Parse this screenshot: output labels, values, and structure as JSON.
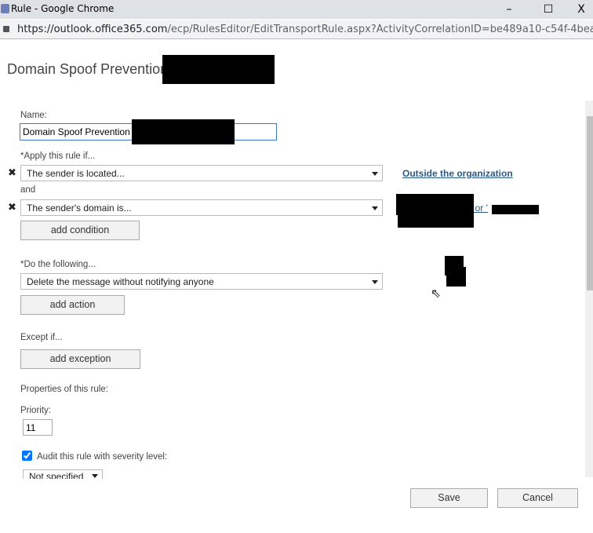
{
  "window": {
    "title": "Rule - Google Chrome",
    "minimize": "–",
    "maximize": "☐",
    "close": "X"
  },
  "address": {
    "host": "https://outlook.office365.com",
    "path": "/ecp/RulesEditor/EditTransportRule.aspx?ActivityCorrelationID=be489a10-c54f-4bea-b..."
  },
  "page": {
    "title": "Domain Spoof Prevention"
  },
  "form": {
    "name_label": "Name:",
    "name_value": "Domain Spoof Prevention",
    "apply_label": "*Apply this rule if...",
    "condition1": "The sender is located...",
    "condition1_value": "Outside the organization",
    "and_label": "and",
    "condition2": "The sender's domain is...",
    "condition2_value_fragment": "' or '",
    "add_condition": "add condition",
    "do_label": "*Do the following...",
    "action1": "Delete the message without notifying anyone",
    "add_action": "add action",
    "except_label": "Except if...",
    "add_exception": "add exception",
    "properties_label": "Properties of this rule:",
    "priority_label": "Priority:",
    "priority_value": "11",
    "audit_label": "Audit this rule with severity level:",
    "audit_checked": true,
    "severity_value": "Not specified",
    "remove_icon": "✖"
  },
  "footer": {
    "save": "Save",
    "cancel": "Cancel"
  }
}
